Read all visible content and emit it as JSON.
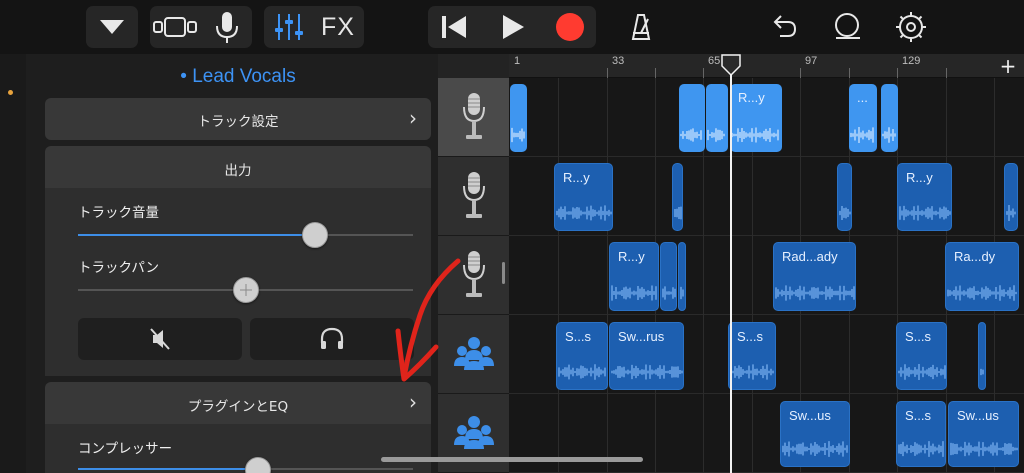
{
  "toolbar": {
    "fx_label": "FX",
    "icons": [
      "browser-triangle-icon",
      "track-view-icon",
      "microphone-icon",
      "mixer-icon",
      "rewind-icon",
      "play-icon",
      "record-icon",
      "metronome-icon",
      "undo-icon",
      "loop-icon",
      "settings-icon"
    ],
    "record_color": "#ff3b30",
    "mixer_color": "#3d93f5"
  },
  "inspector": {
    "track_name": "• Lead Vocals",
    "track_settings_label": "トラック設定",
    "output_label": "出力",
    "volume_label": "トラック音量",
    "volume_level": 0.8,
    "pan_label": "トラックパン",
    "pan_level": 0.5,
    "plugins_label": "プラグインとEQ",
    "compressor_label": "コンプレッサー",
    "compressor_level": 0.5
  },
  "ruler": {
    "marks": [
      "1",
      "33",
      "65",
      "97",
      "129"
    ]
  },
  "tracks": [
    {
      "icon": "microphone-icon",
      "selected": true
    },
    {
      "icon": "microphone-icon",
      "selected": false
    },
    {
      "icon": "microphone-icon",
      "selected": false
    },
    {
      "icon": "group-icon",
      "selected": false
    },
    {
      "icon": "group-icon",
      "selected": false
    }
  ],
  "regions": {
    "t1": [
      "",
      "",
      "",
      "R...y",
      "...",
      ""
    ],
    "t2": [
      "R...y",
      "",
      "",
      "R...y",
      ""
    ],
    "t3": [
      "R...y",
      "",
      "",
      "Rad...ady",
      "Ra...dy"
    ],
    "t4": [
      "S...s",
      "Sw...rus",
      "S...s",
      "S...s",
      ""
    ],
    "t5": [
      "Sw...us",
      "S...s",
      "Sw...us"
    ]
  },
  "add_track_label": "+",
  "accent": "#3d93f5"
}
